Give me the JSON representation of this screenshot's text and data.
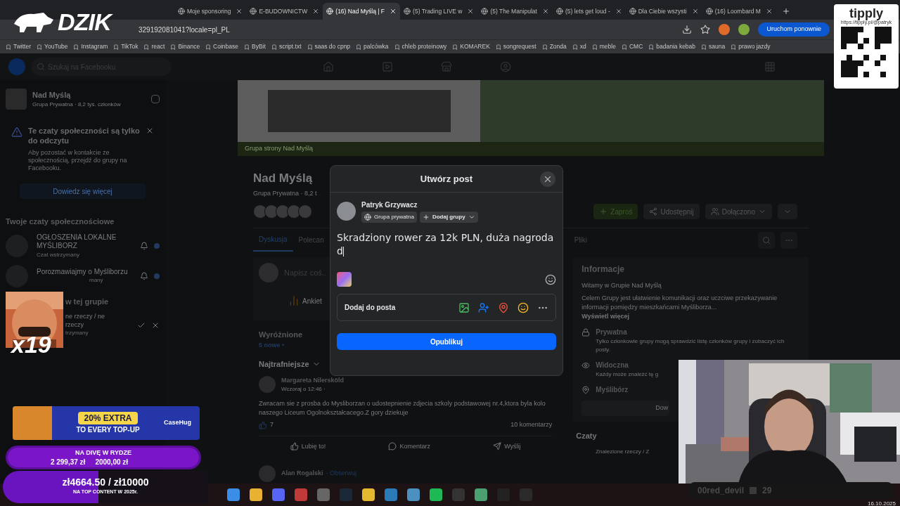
{
  "browser": {
    "tabs": [
      {
        "label": "Moje sponsoring",
        "selected": false
      },
      {
        "label": "E-BUDOWNICTW",
        "selected": false
      },
      {
        "label": "(16) Nad Myślą | F",
        "selected": true
      },
      {
        "label": "(5) Trading LIVE w",
        "selected": false
      },
      {
        "label": "(5) The Manipulat",
        "selected": false
      },
      {
        "label": "(5) lets get loud -",
        "selected": false
      },
      {
        "label": "Dla Ciebie wszysti",
        "selected": false
      },
      {
        "label": "(16) Loombard M",
        "selected": false
      }
    ],
    "address": "329192081041?locale=pl_PL",
    "restart_button": "Uruchom ponownie",
    "bookmarks": [
      "Twitter",
      "YouTube",
      "Instagram",
      "TikTok",
      "react",
      "Binance",
      "Coinbase",
      "ByBit",
      "script.txt",
      "saas do cpnp",
      "palcówka",
      "chleb proteinowy",
      "KOMAREK",
      "songrequest",
      "Zonda",
      "xd",
      "meble",
      "CMC",
      "badania kebab",
      "sauna",
      "prawo jazdy"
    ]
  },
  "facebook": {
    "search_placeholder": "Szukaj na Facebooku",
    "sidebar": {
      "group_name": "Nad Myślą",
      "group_meta": "Grupa Prywatna · 8,2 tys. członków",
      "notice": {
        "title": "Te czaty społeczności są tylko do odczytu",
        "body": "Aby pozostać w kontakcie ze społecznością, przejdź do grupy na Facebooku.",
        "button": "Dowiedz się więcej"
      },
      "chats_heading": "Twoje czaty społecznościowe",
      "chats": [
        {
          "name": "OGŁOSZENIA LOKALNE MYŚLIBORZ",
          "status": "Czat wstrzymany"
        },
        {
          "name": "Porozmawiajmy o Myśliborzu",
          "status": "many"
        }
      ],
      "group_heading": "w tej grupie",
      "group_chat": {
        "name": "ne rzeczy / ne rzeczy",
        "status": "trzymany"
      }
    },
    "cover_caption": "Grupa strony Nad Myślą",
    "group": {
      "name": "Nad Myślą",
      "meta": "Grupa Prywatna · 8,2 t",
      "actions": [
        "Zaproś",
        "Udostępnij",
        "Dołączono"
      ]
    },
    "tabs": [
      {
        "label": "Dyskusja",
        "selected": true
      },
      {
        "label": "Polecan",
        "selected": false
      },
      {
        "label": "Pliki",
        "selected": false
      }
    ],
    "composer": {
      "placeholder": "Napisz coś..",
      "poll": "Ankiet"
    },
    "featured": {
      "title": "Wyróżnione",
      "count": "5 nowe •"
    },
    "sort": "Najtrafniejsze",
    "post": {
      "author": "Margareta Nilersköld",
      "time": "Wczoraj o 12:46 ·",
      "text": "Zwracam sie z prosba do Mysliborzan o udostepnienie zdjecia szkoly podstawowej nr.4,ktora byla kolo naszego Liceum Ogolnokształcacego.Z gory dziekuje",
      "likes": "7",
      "comments": "10 komentarzy",
      "actions": [
        "Lubię to!",
        "Komentarz",
        "Wyślij"
      ]
    },
    "next_post": {
      "author": "Alan Rogalski",
      "follow": "· Obserwuj"
    },
    "info": {
      "title": "Informacje",
      "welcome": "Witamy w Grupie Nad Myślą",
      "description": "Celem Grupy jest ułatwienie komunikacji oraz uczciwe przekazywanie informacji pomiędzy mieszkańcami Myśliborza...",
      "more": "Wyświetl więcej",
      "items": [
        {
          "kind": "lock",
          "title": "Prywatna",
          "text": "Tylko członkowie grupy mogą sprawdzić listę członków grupy i zobaczyć ich posty."
        },
        {
          "kind": "eye",
          "title": "Widoczna",
          "text": "Każdy może znaleźć tę g"
        },
        {
          "kind": "pin",
          "title": "Myślibórz"
        }
      ],
      "button": "Dow",
      "chats_title": "Czaty",
      "chat_preview": "Znalezione rzeczy / Z"
    }
  },
  "modal": {
    "title": "Utwórz post",
    "user": "Patryk Grzywacz",
    "audience": "Grupa prywatna",
    "add_groups": "Dodaj grupy",
    "text": "Skradziony rower za 12k PLN, duża nagroda d",
    "add_to_post": "Dodaj do posta",
    "publish": "Opublikuj"
  },
  "overlays": {
    "logo": "DZIK",
    "tipply": "tipply",
    "tipply_url": "https://tipply.pl/@patryk",
    "emote_count": "x19",
    "promo": {
      "headline": "20% EXTRA",
      "subline": "TO EVERY TOP-UP",
      "brand": "CaseHug"
    },
    "goals": [
      {
        "title": "NA DIVĘ W RYDZE",
        "current": "2 299,37 zł",
        "target": "2000,00 zł",
        "level": 1
      },
      {
        "title": "NA TOP CONTENT W 2025r.",
        "amount": "zł4664.50 / zł10000",
        "level": 0.466
      }
    ],
    "webcam": {
      "name": "00red_devil",
      "count": "29"
    }
  },
  "taskbar": {
    "date": "16.10.2025"
  }
}
